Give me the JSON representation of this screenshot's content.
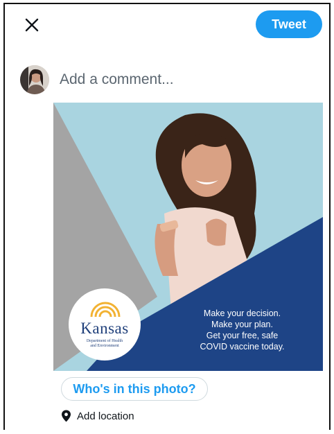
{
  "header": {
    "close_icon": "close-icon",
    "tweet_label": "Tweet"
  },
  "composer": {
    "placeholder": "Add a comment..."
  },
  "photo": {
    "logo": {
      "name": "Kansas",
      "subtitle_line1": "Department of Health",
      "subtitle_line2": "and Environment"
    },
    "caption_lines": [
      "Make your decision.",
      "Make your plan.",
      "Get your free, safe",
      "COVID vaccine today."
    ]
  },
  "actions": {
    "tag_people_label": "Who's in this photo?",
    "location_icon": "location-pin-icon",
    "location_label": "Add location"
  },
  "colors": {
    "accent": "#1d9bf0",
    "photo_sky": "#a9d4e0",
    "photo_gray": "#a4a4a4",
    "photo_navy": "#1e4486"
  }
}
